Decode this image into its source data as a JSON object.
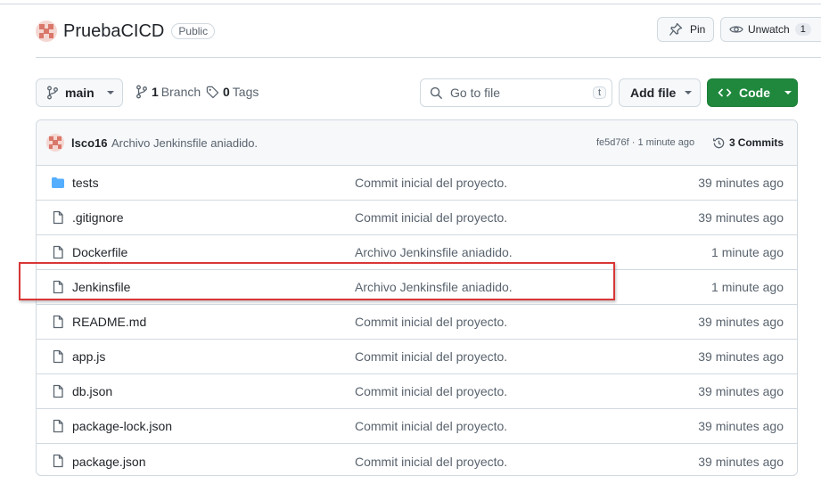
{
  "repo": {
    "name": "PruebaCICD",
    "visibility": "Public"
  },
  "header_buttons": {
    "pin_label": "Pin",
    "watch_label": "Unwatch",
    "watch_count": "1"
  },
  "toolbar": {
    "branch": "main",
    "branch_count": "1",
    "branch_label": "Branch",
    "tag_count": "0",
    "tag_label": "Tags",
    "search_placeholder": "Go to file",
    "search_shortcut": "t",
    "add_file_label": "Add file",
    "code_label": "Code"
  },
  "latest_commit": {
    "author": "lsco16",
    "message": "Archivo Jenkinsfile aniadido.",
    "meta": "fe5d76f · 1 minute ago",
    "commits_count": "3",
    "commits_label": "Commits"
  },
  "files": [
    {
      "name": "tests",
      "type": "folder",
      "message": "Commit inicial del proyecto.",
      "time": "39 minutes ago"
    },
    {
      "name": ".gitignore",
      "type": "file",
      "message": "Commit inicial del proyecto.",
      "time": "39 minutes ago"
    },
    {
      "name": "Dockerfile",
      "type": "file",
      "message": "Archivo Jenkinsfile aniadido.",
      "time": "1 minute ago"
    },
    {
      "name": "Jenkinsfile",
      "type": "file",
      "message": "Archivo Jenkinsfile aniadido.",
      "time": "1 minute ago"
    },
    {
      "name": "README.md",
      "type": "file",
      "message": "Commit inicial del proyecto.",
      "time": "39 minutes ago"
    },
    {
      "name": "app.js",
      "type": "file",
      "message": "Commit inicial del proyecto.",
      "time": "39 minutes ago"
    },
    {
      "name": "db.json",
      "type": "file",
      "message": "Commit inicial del proyecto.",
      "time": "39 minutes ago"
    },
    {
      "name": "package-lock.json",
      "type": "file",
      "message": "Commit inicial del proyecto.",
      "time": "39 minutes ago"
    },
    {
      "name": "package.json",
      "type": "file",
      "message": "Commit inicial del proyecto.",
      "time": "39 minutes ago"
    }
  ],
  "colors": {
    "accent_green": "#1f883d",
    "highlight_red": "#d93636",
    "folder_blue": "#54aeff"
  }
}
